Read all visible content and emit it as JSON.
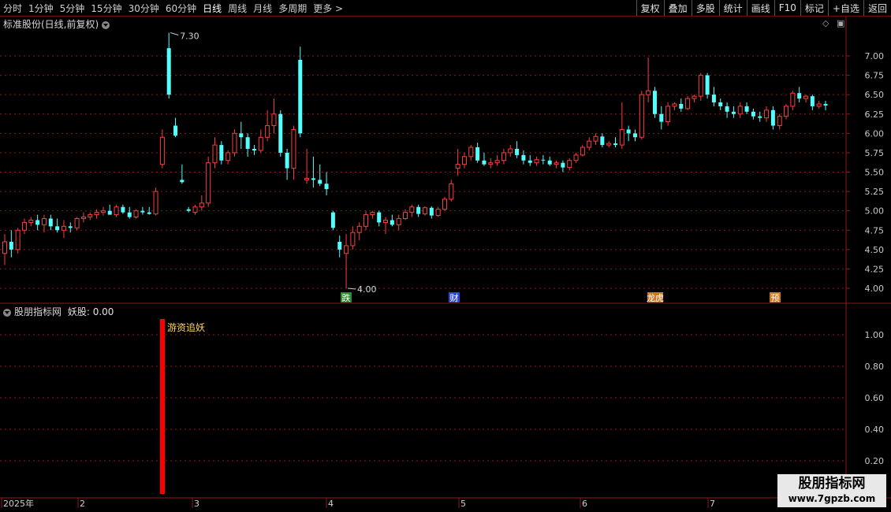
{
  "toolbar": {
    "periods": [
      "分时",
      "1分钟",
      "5分钟",
      "15分钟",
      "30分钟",
      "60分钟",
      "日线",
      "周线",
      "月线",
      "多周期",
      "更多 >"
    ],
    "active_period": "日线",
    "actions": [
      "复权",
      "叠加",
      "多股",
      "统计",
      "画线",
      "F10",
      "标记",
      "+自选",
      "返回"
    ]
  },
  "main_chart": {
    "title": "标准股份(日线,前复权)",
    "y_labels": [
      "7.00",
      "6.75",
      "6.50",
      "6.25",
      "6.00",
      "5.75",
      "5.50",
      "5.25",
      "5.00",
      "4.75",
      "4.50",
      "4.25",
      "4.00"
    ],
    "high_marker": "7.30",
    "low_marker": "4.00",
    "event_badges": [
      {
        "label": "跌",
        "color": "#2e8b2e"
      },
      {
        "label": "财",
        "color": "#2a4bd0"
      },
      {
        "label": "龙虎",
        "color": "#c87a2a"
      },
      {
        "label": "预",
        "color": "#c87a2a"
      }
    ]
  },
  "indicator": {
    "title": "股朋指标网",
    "name_label": "妖股: 0.00",
    "signal_label": "游资追妖",
    "y_labels": [
      "1.00",
      "0.80",
      "0.60",
      "0.40",
      "0.20"
    ]
  },
  "x_axis": {
    "labels": [
      "2025年",
      "2",
      "3",
      "4",
      "5",
      "6",
      "7"
    ]
  },
  "colors": {
    "up": "#ff3c3c",
    "down": "#54ffff",
    "signal": "#ff0000",
    "grid": "#8b1a1a"
  },
  "watermark": {
    "line1": "股朋指标网",
    "line2": "www.7gpzb.com"
  }
}
